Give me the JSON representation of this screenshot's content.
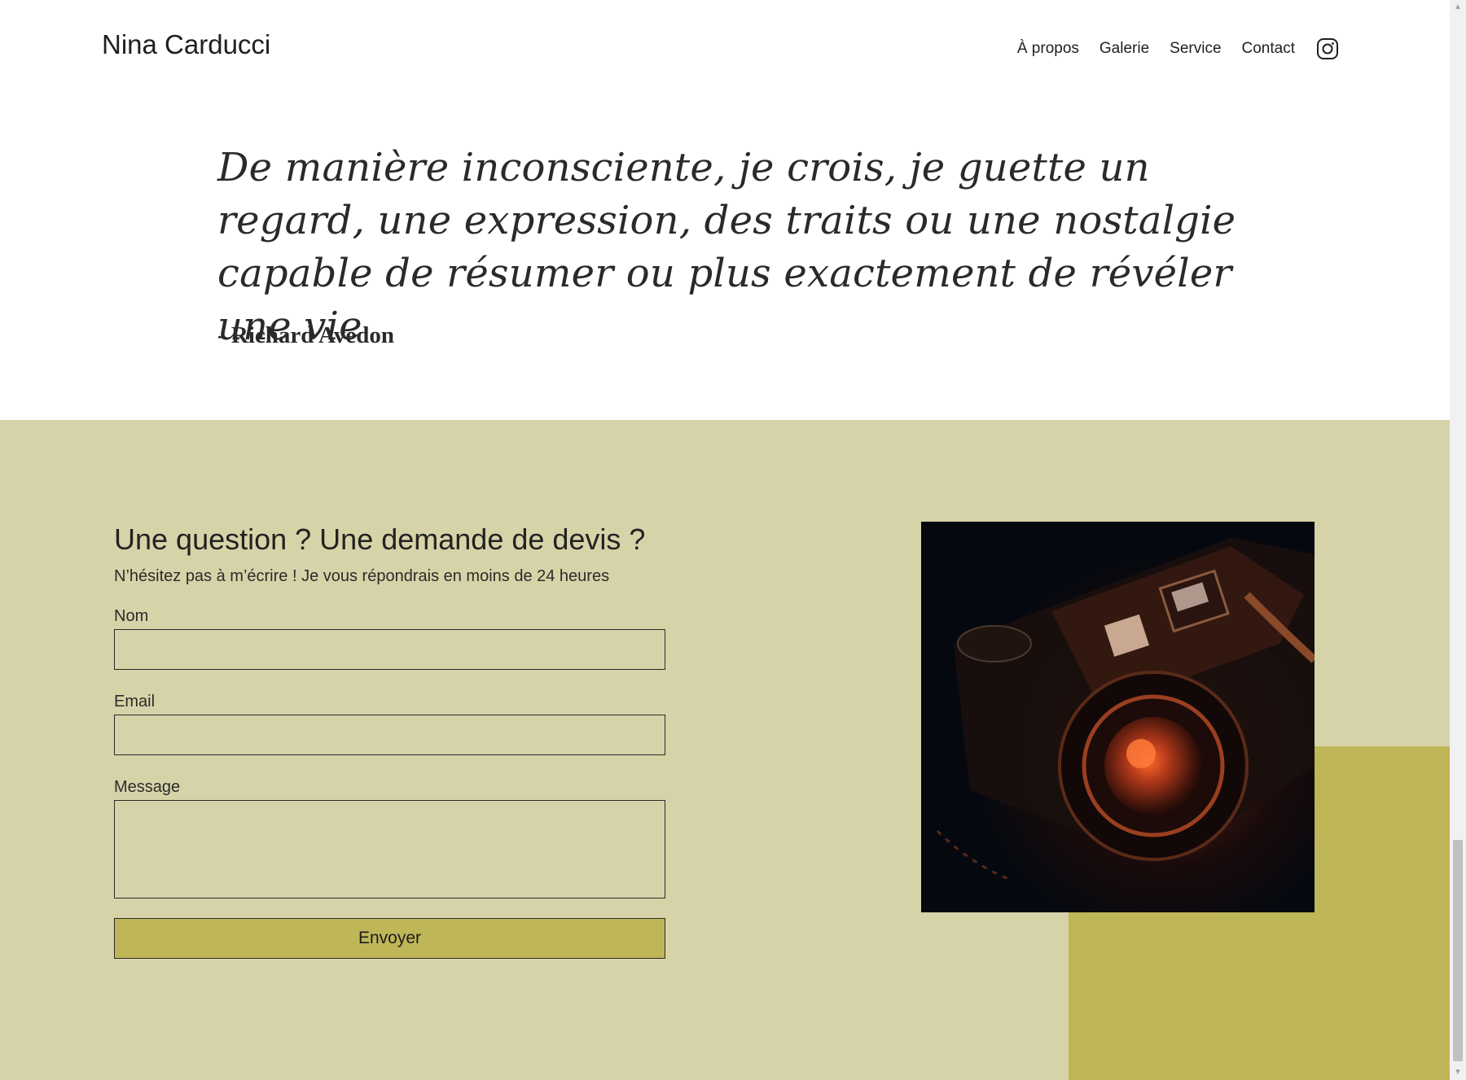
{
  "header": {
    "brand": "Nina Carducci",
    "nav": [
      "À propos",
      "Galerie",
      "Service",
      "Contact"
    ],
    "instagram_icon": "instagram-icon"
  },
  "quote": {
    "text": "De manière inconsciente, je crois, je guette un regard, une expression, des traits ou une nostalgie capable de résumer ou plus exactement de révéler une vie",
    "author": "- Richard Avedon"
  },
  "contact": {
    "title": "Une question ? Une demande de devis ?",
    "subtitle": "N’hésitez pas à m’écrire ! Je vous répondrais en moins de 24 heures",
    "name_label": "Nom",
    "name_value": "",
    "email_label": "Email",
    "email_value": "",
    "message_label": "Message",
    "message_value": "",
    "submit_label": "Envoyer",
    "colors": {
      "background": "#d7d3a8",
      "accent": "#bfb658"
    }
  },
  "photo": {
    "subject": "camera-photo"
  }
}
